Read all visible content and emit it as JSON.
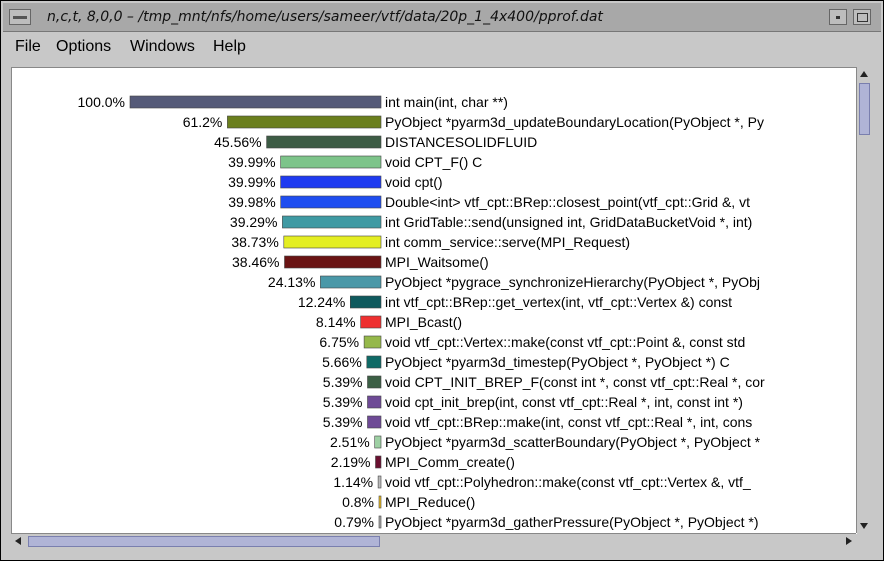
{
  "window": {
    "title": "n,c,t, 8,0,0 – /tmp_mnt/nfs/home/users/sameer/vtf/data/20p_1_4x400/pprof.dat"
  },
  "menu": {
    "file": "File",
    "options": "Options",
    "windows": "Windows",
    "help": "Help"
  },
  "icons": {
    "system_menu": "window-menu-icon",
    "minimize": "minimize-icon",
    "maximize": "maximize-icon",
    "scroll_up": "arrow-up-icon",
    "scroll_down": "arrow-down-icon",
    "scroll_left": "arrow-left-icon",
    "scroll_right": "arrow-right-icon"
  },
  "chart_data": {
    "type": "bar",
    "orientation": "horizontal",
    "xlim": [
      0,
      100
    ],
    "categories": [
      "int main(int, char **)",
      "PyObject *pyarm3d_updateBoundaryLocation(PyObject *, Py",
      "DISTANCESOLIDFLUID",
      "void CPT_F() C",
      "void cpt()",
      "Double<int> vtf_cpt::BRep::closest_point(vtf_cpt::Grid &, vt",
      "int GridTable::send(unsigned int, GridDataBucketVoid *, int)",
      "int comm_service::serve(MPI_Request)",
      "MPI_Waitsome()",
      "PyObject *pygrace_synchronizeHierarchy(PyObject *, PyObj",
      "int vtf_cpt::BRep::get_vertex(int, vtf_cpt::Vertex &) const",
      "MPI_Bcast()",
      "void vtf_cpt::Vertex::make(const vtf_cpt::Point &, const std",
      "PyObject *pyarm3d_timestep(PyObject *, PyObject *) C",
      "void CPT_INIT_BREP_F(const int *, const vtf_cpt::Real *, cor",
      "void cpt_init_brep(int, const vtf_cpt::Real *, int, const int *)",
      "void vtf_cpt::BRep::make(int, const vtf_cpt::Real *, int, cons",
      "PyObject *pyarm3d_scatterBoundary(PyObject *, PyObject *",
      "MPI_Comm_create()",
      "void vtf_cpt::Polyhedron::make(const vtf_cpt::Vertex &, vtf_",
      "MPI_Reduce()",
      "PyObject *pyarm3d_gatherPressure(PyObject *, PyObject *)"
    ],
    "values": [
      100.0,
      61.2,
      45.56,
      39.99,
      39.99,
      39.98,
      39.29,
      38.73,
      38.46,
      24.13,
      12.24,
      8.14,
      6.75,
      5.66,
      5.39,
      5.39,
      5.39,
      2.51,
      2.19,
      1.14,
      0.8,
      0.79
    ],
    "value_labels": [
      "100.0%",
      "61.2%",
      "45.56%",
      "39.99%",
      "39.99%",
      "39.98%",
      "39.29%",
      "38.73%",
      "38.46%",
      "24.13%",
      "12.24%",
      "8.14%",
      "6.75%",
      "5.66%",
      "5.39%",
      "5.39%",
      "5.39%",
      "2.51%",
      "2.19%",
      "1.14%",
      "0.8%",
      "0.79%"
    ],
    "colors": [
      "#555a78",
      "#6b7f1e",
      "#3d5c45",
      "#7dc48a",
      "#1f3bf0",
      "#1f4ef0",
      "#3f9aa3",
      "#e4ee22",
      "#6a1414",
      "#4a98a8",
      "#0f5a5e",
      "#ee3030",
      "#95b84a",
      "#0f6a66",
      "#3c5f45",
      "#6e4a96",
      "#6e4a96",
      "#9ed0a4",
      "#6a1030",
      "#bbbbbb",
      "#f0c020",
      "#aaaaaa"
    ]
  }
}
